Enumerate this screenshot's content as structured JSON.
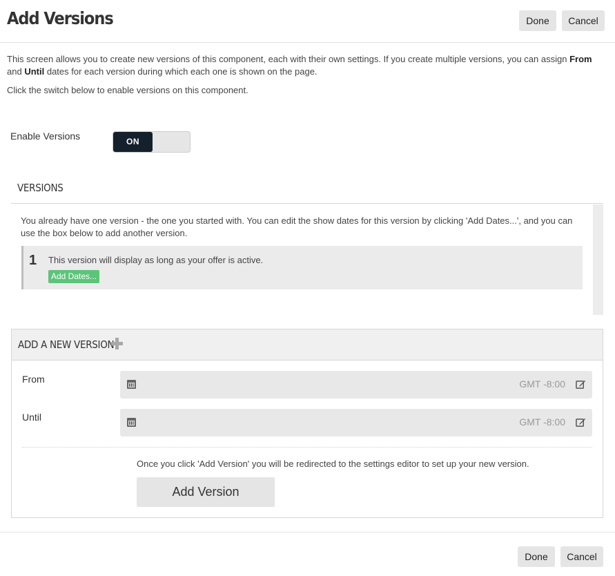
{
  "header": {
    "title": "Add Versions",
    "done_label": "Done",
    "cancel_label": "Cancel"
  },
  "intro": {
    "line1_a": "This screen allows you to create new versions of this component, each with their own settings. If you create multiple versions, you can assign",
    "from": "From",
    "and": "and",
    "until": "Until",
    "line1_b": "dates for each version during which each one is shown on the page.",
    "line2": "Click the switch below to enable versions on this component."
  },
  "enable": {
    "label": "Enable Versions",
    "toggle_state": "ON"
  },
  "versions": {
    "title": "VERSIONS",
    "description": "You already have one version - the one you started with. You can edit the show dates for this version by clicking 'Add Dates...', and you can use the box below to add another version.",
    "items": [
      {
        "number": "1",
        "text": "This version will display as long as your offer is active.",
        "button": "Add Dates..."
      }
    ]
  },
  "new_version": {
    "title": "ADD A NEW VERSION",
    "from_label": "From",
    "until_label": "Until",
    "from_value": "",
    "until_value": "",
    "timezone": "GMT -8:00",
    "note": "Once you click 'Add Version' you will be redirected to the settings editor to set up your new version.",
    "button": "Add Version"
  },
  "footer": {
    "done_label": "Done",
    "cancel_label": "Cancel"
  },
  "colors": {
    "toggle_on": "#14202b",
    "add_dates": "#5cc47a",
    "button_gray": "#e5e5e5"
  },
  "icons": [
    "calendar-icon",
    "edit-icon",
    "plus-icon"
  ]
}
